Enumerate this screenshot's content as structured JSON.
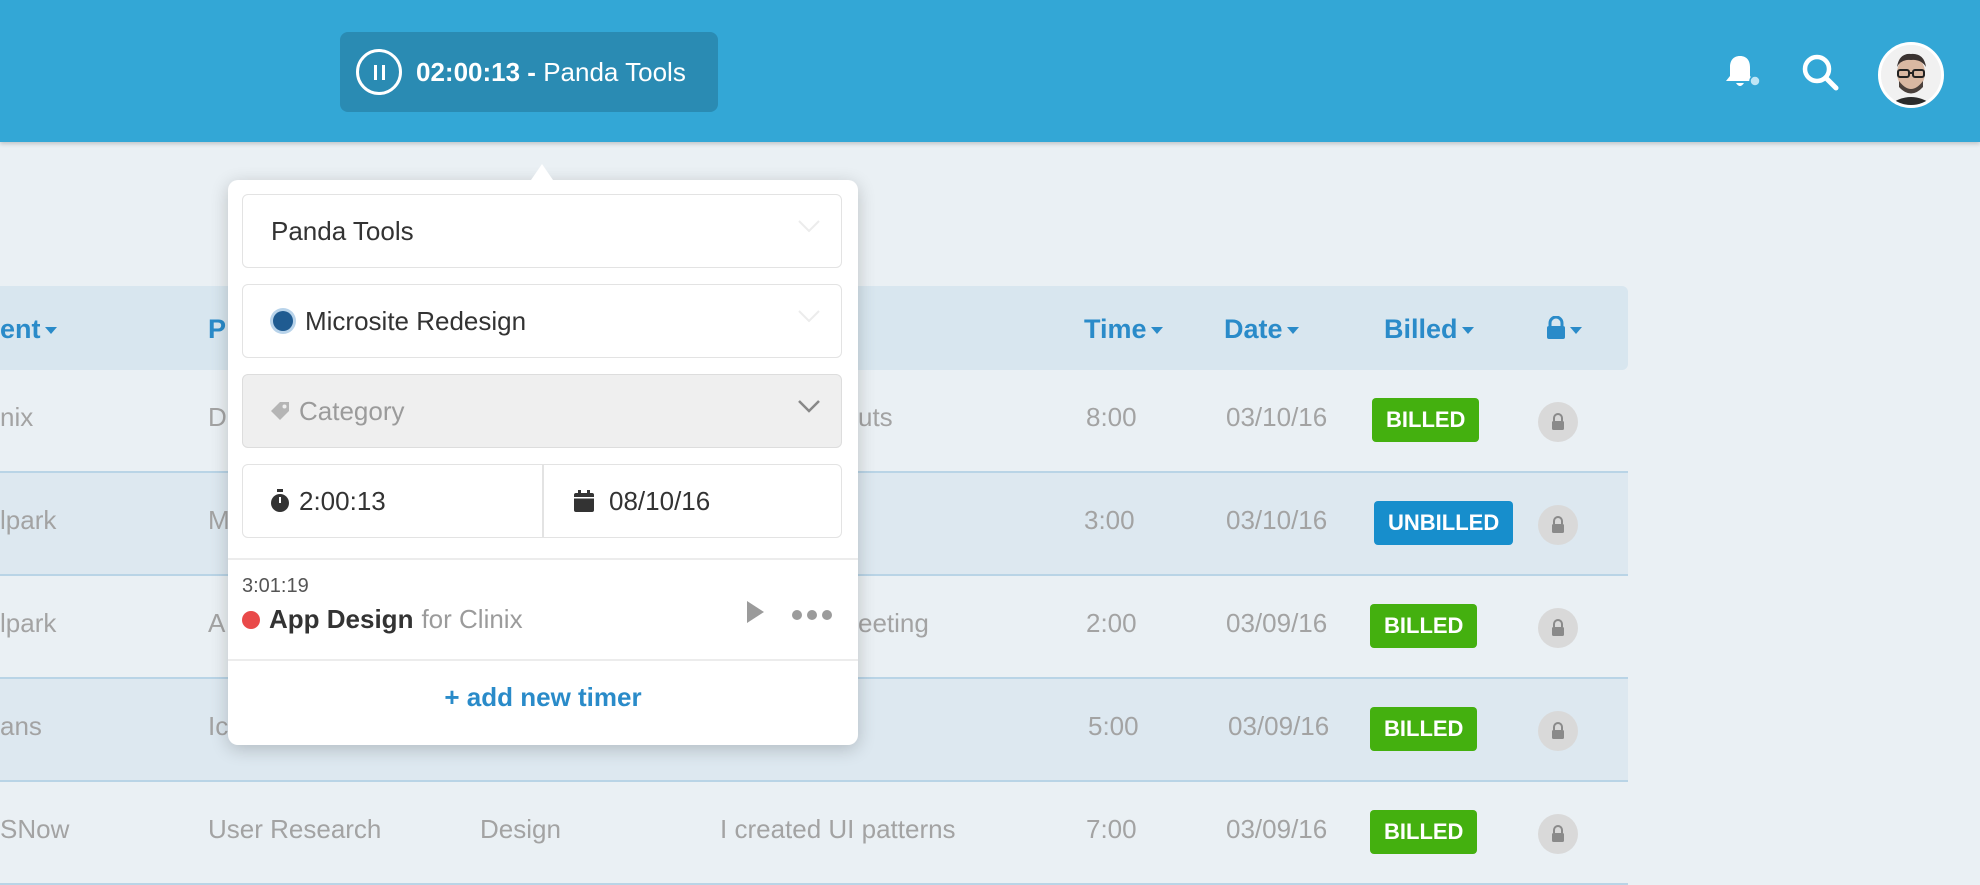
{
  "topbar": {
    "timer_time": "02:00:13",
    "timer_separator": " - ",
    "timer_project": "Panda Tools"
  },
  "table": {
    "headers": {
      "client": "ent",
      "project": "P",
      "time": "Time",
      "date": "Date",
      "billed": "Billed"
    },
    "rows": [
      {
        "client": "nix",
        "project": "D",
        "notes": "uts",
        "time": "8:00",
        "date": "03/10/16",
        "status": "BILLED"
      },
      {
        "client": "lpark",
        "project": "M",
        "notes": "",
        "time": "3:00",
        "date": "03/10/16",
        "status": "UNBILLED"
      },
      {
        "client": "lpark",
        "project": "A",
        "notes": "eeting",
        "time": "2:00",
        "date": "03/09/16",
        "status": "BILLED"
      },
      {
        "client": "ans",
        "project": "Ic",
        "notes": "",
        "time": "5:00",
        "date": "03/09/16",
        "status": "BILLED"
      },
      {
        "client": "SNow",
        "project": "User Research",
        "category": "Design",
        "notes": "I created UI patterns",
        "time": "7:00",
        "date": "03/09/16",
        "status": "BILLED"
      }
    ]
  },
  "popover": {
    "client": "Panda Tools",
    "project": "Microsite Redesign",
    "category_placeholder": "Category",
    "duration": "2:00:13",
    "date": "08/10/16",
    "recent": {
      "time": "3:01:19",
      "project": "App Design",
      "client_prefix": "for Clinix"
    },
    "add_timer": "+ add new timer"
  },
  "colors": {
    "topbar": "#33a7d6",
    "accent": "#2a8bc9",
    "billed": "#44b00f",
    "unbilled": "#178ecc"
  }
}
